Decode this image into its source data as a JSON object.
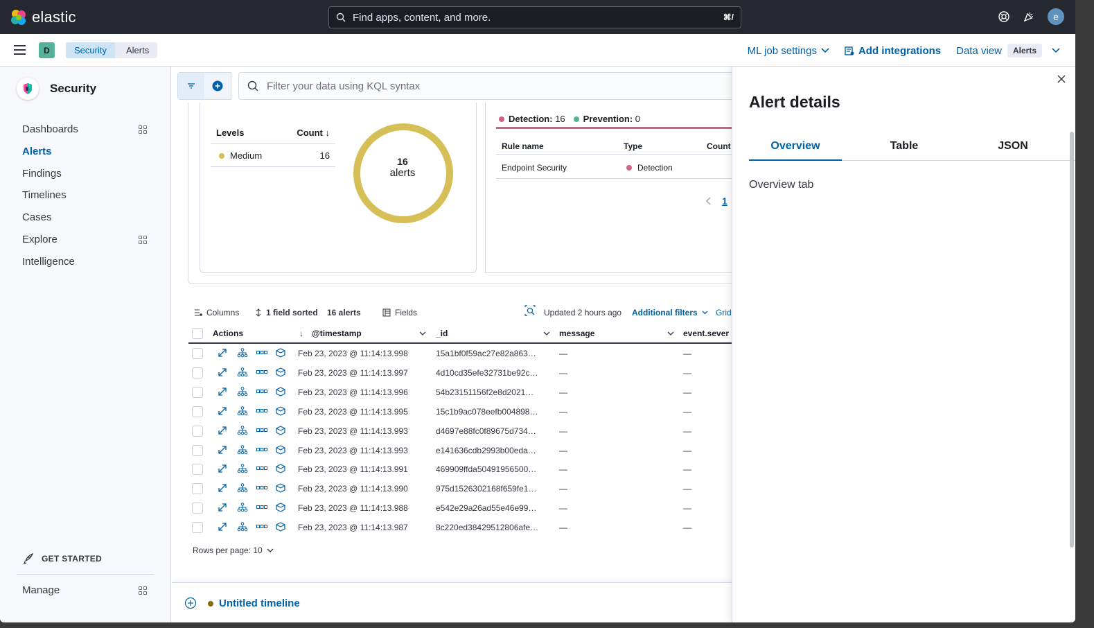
{
  "topbar": {
    "brand": "elastic",
    "search_placeholder": "Find apps, content, and more.",
    "shortcut": "⌘/",
    "avatar_initial": "e"
  },
  "navbar": {
    "space_initial": "D",
    "breadcrumbs": [
      "Security",
      "Alerts"
    ],
    "ml_job_settings": "ML job settings",
    "add_integrations": "Add integrations",
    "data_view_label": "Data view",
    "data_view_value": "Alerts"
  },
  "sidebar": {
    "title": "Security",
    "items": [
      {
        "label": "Dashboards"
      },
      {
        "label": "Alerts"
      },
      {
        "label": "Findings"
      },
      {
        "label": "Timelines"
      },
      {
        "label": "Cases"
      },
      {
        "label": "Explore"
      },
      {
        "label": "Intelligence"
      }
    ],
    "get_started": "GET STARTED",
    "manage": "Manage"
  },
  "filter": {
    "kql_placeholder": "Filter your data using KQL syntax"
  },
  "severity_panel": {
    "col_levels": "Levels",
    "col_count": "Count",
    "row_level": "Medium",
    "row_count": "16",
    "donut_count": "16",
    "donut_unit": "alerts",
    "medium_color": "#d6bf57"
  },
  "rules_panel": {
    "legend_detection": "Detection:",
    "detection_count": "16",
    "legend_prevention": "Prevention:",
    "prevention_count": "0",
    "col_rule": "Rule name",
    "col_type": "Type",
    "col_count": "Count",
    "row_rule": "Endpoint Security",
    "row_type": "Detection",
    "page": "1",
    "detection_color": "#d36086",
    "prevention_color": "#54b399"
  },
  "toolbar": {
    "columns": "Columns",
    "sorted": "1 field sorted",
    "alerts_count": "16 alerts",
    "fields": "Fields",
    "updated": "Updated 2 hours ago",
    "additional_filters": "Additional filters",
    "grid": "Grid"
  },
  "table": {
    "headers": {
      "actions": "Actions",
      "timestamp": "@timestamp",
      "id": "_id",
      "message": "message",
      "severity": "event.sever"
    },
    "rows": [
      {
        "ts": "Feb 23, 2023 @ 11:14:13.998",
        "id": "15a1bf0f59ac27e82a863…",
        "msg": "—",
        "sev": "—"
      },
      {
        "ts": "Feb 23, 2023 @ 11:14:13.997",
        "id": "4d10cd35efe32731be92c…",
        "msg": "—",
        "sev": "—"
      },
      {
        "ts": "Feb 23, 2023 @ 11:14:13.996",
        "id": "54b23151156f2e8d2021…",
        "msg": "—",
        "sev": "—"
      },
      {
        "ts": "Feb 23, 2023 @ 11:14:13.995",
        "id": "15c1b9ac078eefb004898…",
        "msg": "—",
        "sev": "—"
      },
      {
        "ts": "Feb 23, 2023 @ 11:14:13.993",
        "id": "d4697e88fc0f89675d734…",
        "msg": "—",
        "sev": "—"
      },
      {
        "ts": "Feb 23, 2023 @ 11:14:13.993",
        "id": "e141636cdb2993b00eda…",
        "msg": "—",
        "sev": "—"
      },
      {
        "ts": "Feb 23, 2023 @ 11:14:13.991",
        "id": "469909ffda50491956500…",
        "msg": "—",
        "sev": "—"
      },
      {
        "ts": "Feb 23, 2023 @ 11:14:13.990",
        "id": "975d1526302168f659fe1…",
        "msg": "—",
        "sev": "—"
      },
      {
        "ts": "Feb 23, 2023 @ 11:14:13.988",
        "id": "e542e29a26ad55e46e99…",
        "msg": "—",
        "sev": "—"
      },
      {
        "ts": "Feb 23, 2023 @ 11:14:13.987",
        "id": "8c220ed38429512806afe…",
        "msg": "—",
        "sev": "—"
      }
    ],
    "rows_per_page": "Rows per page: 10"
  },
  "timeline": {
    "title": "Untitled timeline"
  },
  "flyout": {
    "title": "Alert details",
    "tabs": [
      "Overview",
      "Table",
      "JSON"
    ],
    "body": "Overview tab"
  }
}
